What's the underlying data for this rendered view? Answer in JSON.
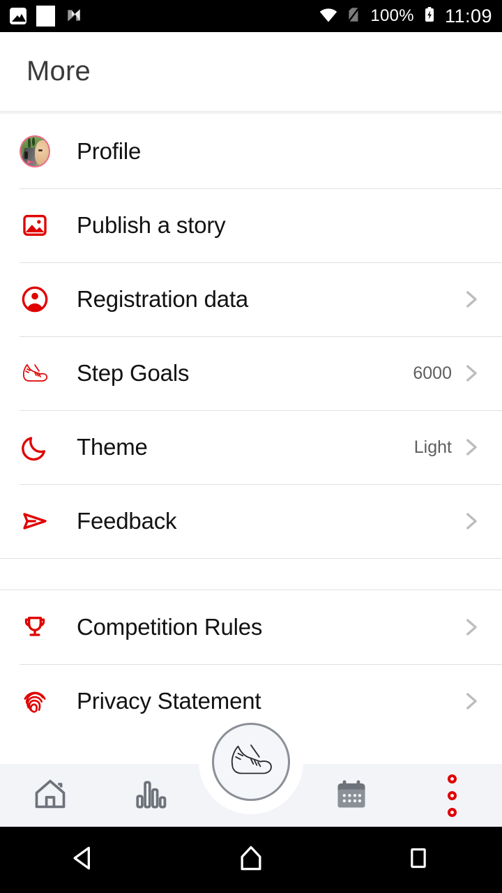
{
  "status_bar": {
    "icons": [
      "photo-icon",
      "blank-notification-icon",
      "n-app-icon"
    ],
    "wifi_icon": "wifi-icon",
    "signal_icon": "no-sim-icon",
    "battery_percent": "100%",
    "battery_icon": "battery-charging-icon",
    "time": "11:09"
  },
  "app_bar": {
    "title": "More"
  },
  "colors": {
    "accent_red": "#e00000",
    "text_primary": "#121212",
    "text_secondary": "#5e5e5e",
    "chevron": "#bdbdbd",
    "divider": "#e0e0e0",
    "bottom_nav_bg": "#f2f4f7",
    "nav_icon": "#6e727a"
  },
  "groups": [
    {
      "items": [
        {
          "icon": "avatar",
          "label": "Profile",
          "value": "",
          "chevron": false
        },
        {
          "icon": "image-icon",
          "label": "Publish a story",
          "value": "",
          "chevron": false
        },
        {
          "icon": "account-circle-icon",
          "label": "Registration data",
          "value": "",
          "chevron": true
        },
        {
          "icon": "running-shoe-icon",
          "label": "Step Goals",
          "value": "6000",
          "chevron": true
        },
        {
          "icon": "moon-icon",
          "label": "Theme",
          "value": "Light",
          "chevron": true
        },
        {
          "icon": "send-icon",
          "label": "Feedback",
          "value": "",
          "chevron": true
        }
      ]
    },
    {
      "items": [
        {
          "icon": "trophy-icon",
          "label": "Competition Rules",
          "value": "",
          "chevron": true
        },
        {
          "icon": "fingerprint-icon",
          "label": "Privacy Statement",
          "value": "",
          "chevron": true
        }
      ]
    }
  ],
  "bottom_nav": {
    "items": [
      {
        "icon": "home-icon",
        "name": "home",
        "active": false
      },
      {
        "icon": "bar-chart-icon",
        "name": "statistics",
        "active": false
      },
      {
        "icon": "running-shoe-icon",
        "name": "activity",
        "active": false,
        "is_fab": true
      },
      {
        "icon": "calendar-icon",
        "name": "calendar",
        "active": false
      },
      {
        "icon": "more-dots-icon",
        "name": "more",
        "active": true
      }
    ]
  },
  "android_nav": {
    "back": "back-icon",
    "home": "home-icon",
    "recents": "recents-icon"
  }
}
